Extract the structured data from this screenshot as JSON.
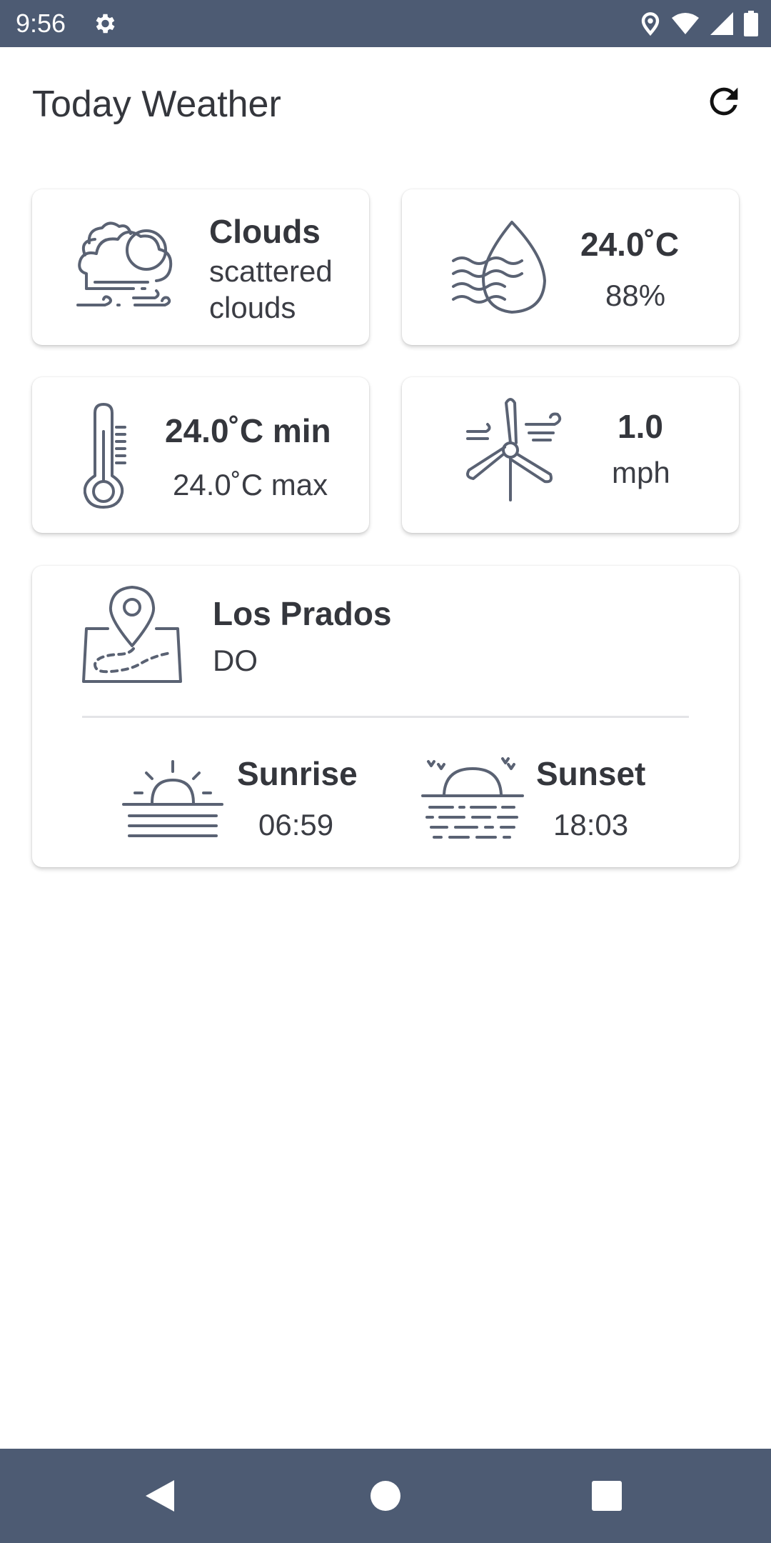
{
  "status_bar": {
    "time": "9:56",
    "icons": [
      "gear-icon",
      "location-icon",
      "wifi-icon",
      "signal-icon",
      "battery-icon"
    ]
  },
  "app_bar": {
    "title": "Today Weather",
    "refresh_icon": "refresh-icon"
  },
  "weather": {
    "main": "Clouds",
    "description_line1": "scattered",
    "description_line2": "clouds",
    "icon": "clouds-icon"
  },
  "humidity": {
    "temperature": "24.0˚C",
    "percent": "88%",
    "icon": "humidity-drop-icon"
  },
  "temperature": {
    "min": "24.0˚C min",
    "max": "24.0˚C max",
    "icon": "thermometer-icon"
  },
  "wind": {
    "speed": "1.0",
    "unit": "mph",
    "icon": "wind-turbine-icon"
  },
  "location": {
    "city": "Los Prados",
    "country": "DO",
    "icon": "map-pin-icon"
  },
  "sun": {
    "sunrise_label": "Sunrise",
    "sunrise_time": "06:59",
    "sunset_label": "Sunset",
    "sunset_time": "18:03"
  },
  "nav_bar": {
    "buttons": [
      "back-icon",
      "home-icon",
      "recents-icon"
    ]
  },
  "colors": {
    "bars": "#4d5b73",
    "icon_stroke": "#5a6273",
    "text": "#34363c"
  }
}
